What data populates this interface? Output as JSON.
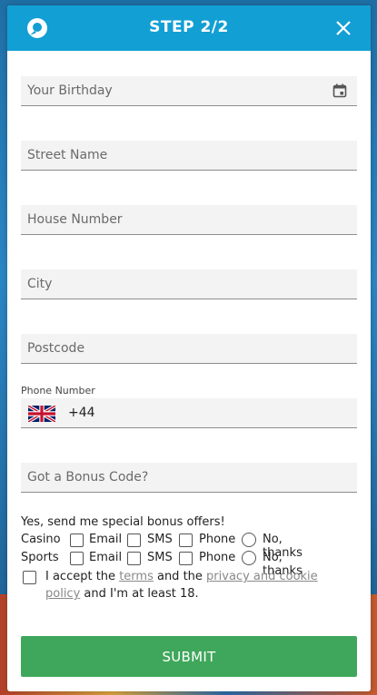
{
  "header": {
    "title": "STEP 2/2",
    "logo_icon": "chat-bubble-logo-icon",
    "close_icon": "close-icon",
    "color": "#129fd4"
  },
  "fields": {
    "birthday": {
      "placeholder": "Your Birthday",
      "icon": "calendar-icon"
    },
    "street": {
      "placeholder": "Street Name"
    },
    "house_number": {
      "placeholder": "House Number"
    },
    "city": {
      "placeholder": "City"
    },
    "postcode": {
      "placeholder": "Postcode"
    },
    "phone": {
      "label": "Phone Number",
      "country_flag": "uk-flag-icon",
      "prefix": "+44"
    },
    "bonus_code": {
      "placeholder": "Got a Bonus Code?"
    }
  },
  "offers": {
    "title": "Yes, send me special bonus offers!",
    "rows": [
      {
        "label": "Casino",
        "options": [
          "Email",
          "SMS",
          "Phone"
        ],
        "decline": "No, thanks"
      },
      {
        "label": "Sports",
        "options": [
          "Email",
          "SMS",
          "Phone"
        ],
        "decline": "No, thanks"
      }
    ]
  },
  "terms": {
    "prefix": "I accept the ",
    "terms_link": "terms",
    "middle": " and the ",
    "privacy_link": "privacy and cookie policy",
    "suffix": " and I'm at least 18."
  },
  "submit": {
    "label": "SUBMIT",
    "color": "#3fa75b"
  }
}
